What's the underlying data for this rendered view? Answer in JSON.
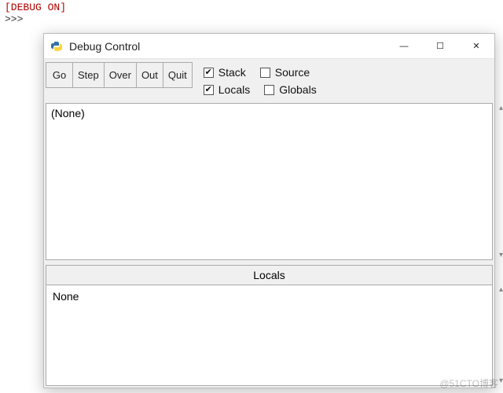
{
  "shell": {
    "status": "[DEBUG ON]",
    "prompt": ">>>"
  },
  "window": {
    "title": "Debug Control",
    "controls": {
      "minimize": "—",
      "maximize": "☐",
      "close": "✕"
    }
  },
  "toolbar": {
    "buttons": [
      "Go",
      "Step",
      "Over",
      "Out",
      "Quit"
    ]
  },
  "checks": {
    "stack": {
      "label": "Stack",
      "checked": true
    },
    "source": {
      "label": "Source",
      "checked": false
    },
    "locals": {
      "label": "Locals",
      "checked": true
    },
    "globals": {
      "label": "Globals",
      "checked": false
    }
  },
  "panes": {
    "stack_content": "(None)",
    "locals_header": "Locals",
    "locals_content": "None"
  },
  "watermark": "@51CTO博客"
}
